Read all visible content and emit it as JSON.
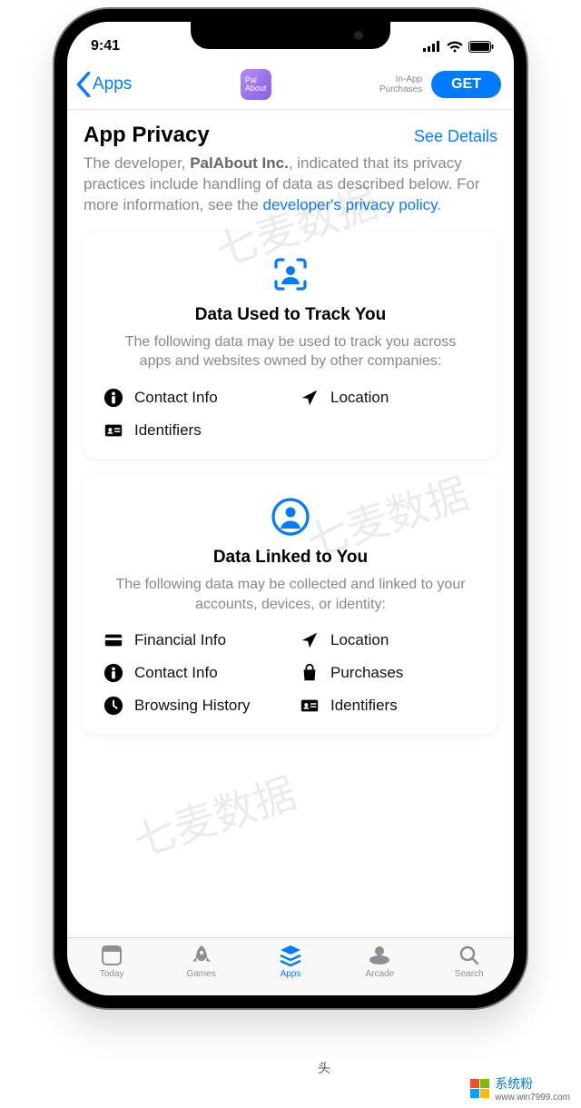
{
  "status": {
    "time": "9:41"
  },
  "nav": {
    "back_label": "Apps",
    "app_icon_text": "Pal\nAbout",
    "iap_line1": "In-App",
    "iap_line2": "Purchases",
    "get_label": "GET"
  },
  "header": {
    "title": "App Privacy",
    "see_details": "See Details"
  },
  "intro": {
    "prefix": "The developer, ",
    "developer": "PalAbout Inc.",
    "middle": ", indicated that its privacy practices include handling of data as described below. For more information, see the ",
    "link": "developer's privacy policy",
    "suffix": "."
  },
  "cards": {
    "track": {
      "title": "Data Used to Track You",
      "subtitle": "The following data may be used to track you across apps and websites owned by other companies:",
      "items": [
        "Contact Info",
        "Location",
        "Identifiers"
      ]
    },
    "linked": {
      "title": "Data Linked to You",
      "subtitle": "The following data may be collected and linked to your accounts, devices, or identity:",
      "items": [
        "Financial Info",
        "Location",
        "Contact Info",
        "Purchases",
        "Browsing History",
        "Identifiers"
      ]
    }
  },
  "tabs": [
    "Today",
    "Games",
    "Apps",
    "Arcade",
    "Search"
  ],
  "watermark": "七麦数据",
  "footer": {
    "credit_site": "系统粉",
    "credit_url": "www.win7999.com"
  }
}
